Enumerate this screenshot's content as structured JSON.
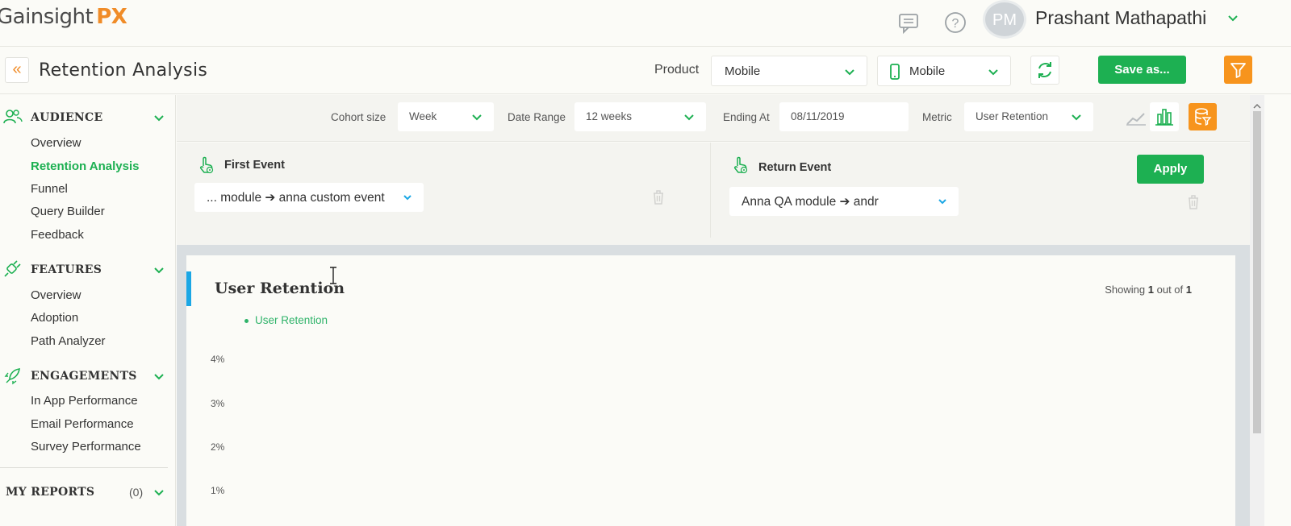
{
  "brand": {
    "logo_text": "Gainsight",
    "logo_suffix": "PX"
  },
  "topbar": {
    "chat_icon": "chat-bubble-icon",
    "help_icon": "help-circle-icon",
    "user_initials": "PM",
    "user_name": "Prashant Mathapathi"
  },
  "header": {
    "title": "Retention Analysis",
    "product_label": "Product",
    "product_value": "Mobile",
    "platform_value": "Mobile",
    "save_label": "Save as..."
  },
  "sidebar": {
    "audience": {
      "label": "AUDIENCE",
      "items": [
        "Overview",
        "Retention Analysis",
        "Funnel",
        "Query Builder",
        "Feedback"
      ]
    },
    "features": {
      "label": "FEATURES",
      "items": [
        "Overview",
        "Adoption",
        "Path Analyzer"
      ]
    },
    "engagements": {
      "label": "ENGAGEMENTS",
      "items": [
        "In App Performance",
        "Email Performance",
        "Survey Performance"
      ]
    },
    "reports": {
      "label": "MY REPORTS",
      "count": "(0)"
    }
  },
  "filters": {
    "cohort_label": "Cohort size",
    "cohort_value": "Week",
    "range_label": "Date Range",
    "range_value": "12 weeks",
    "ending_label": "Ending At",
    "ending_value": "08/11/2019",
    "metric_label": "Metric",
    "metric_value": "User Retention"
  },
  "events": {
    "first_title": "First Event",
    "first_value": "... module ➔ anna custom event",
    "return_title": "Return Event",
    "return_value": "Anna QA module ➔ andr",
    "apply_label": "Apply"
  },
  "chart": {
    "title": "User Retention",
    "showing_prefix": "Showing",
    "showing_current": "1",
    "showing_mid": "out of",
    "showing_total": "1"
  },
  "chart_data": {
    "type": "bar",
    "title": "User Retention",
    "series": [
      {
        "name": "User Retention",
        "values": []
      }
    ],
    "yticks": [
      "4%",
      "3%",
      "2%",
      "1%"
    ],
    "ylim": [
      0,
      4
    ],
    "grid": false,
    "legend_position": "top-left"
  },
  "colors": {
    "primary_green": "#1db052",
    "accent_orange": "#f7941d",
    "accent_blue": "#1ba7e5"
  }
}
